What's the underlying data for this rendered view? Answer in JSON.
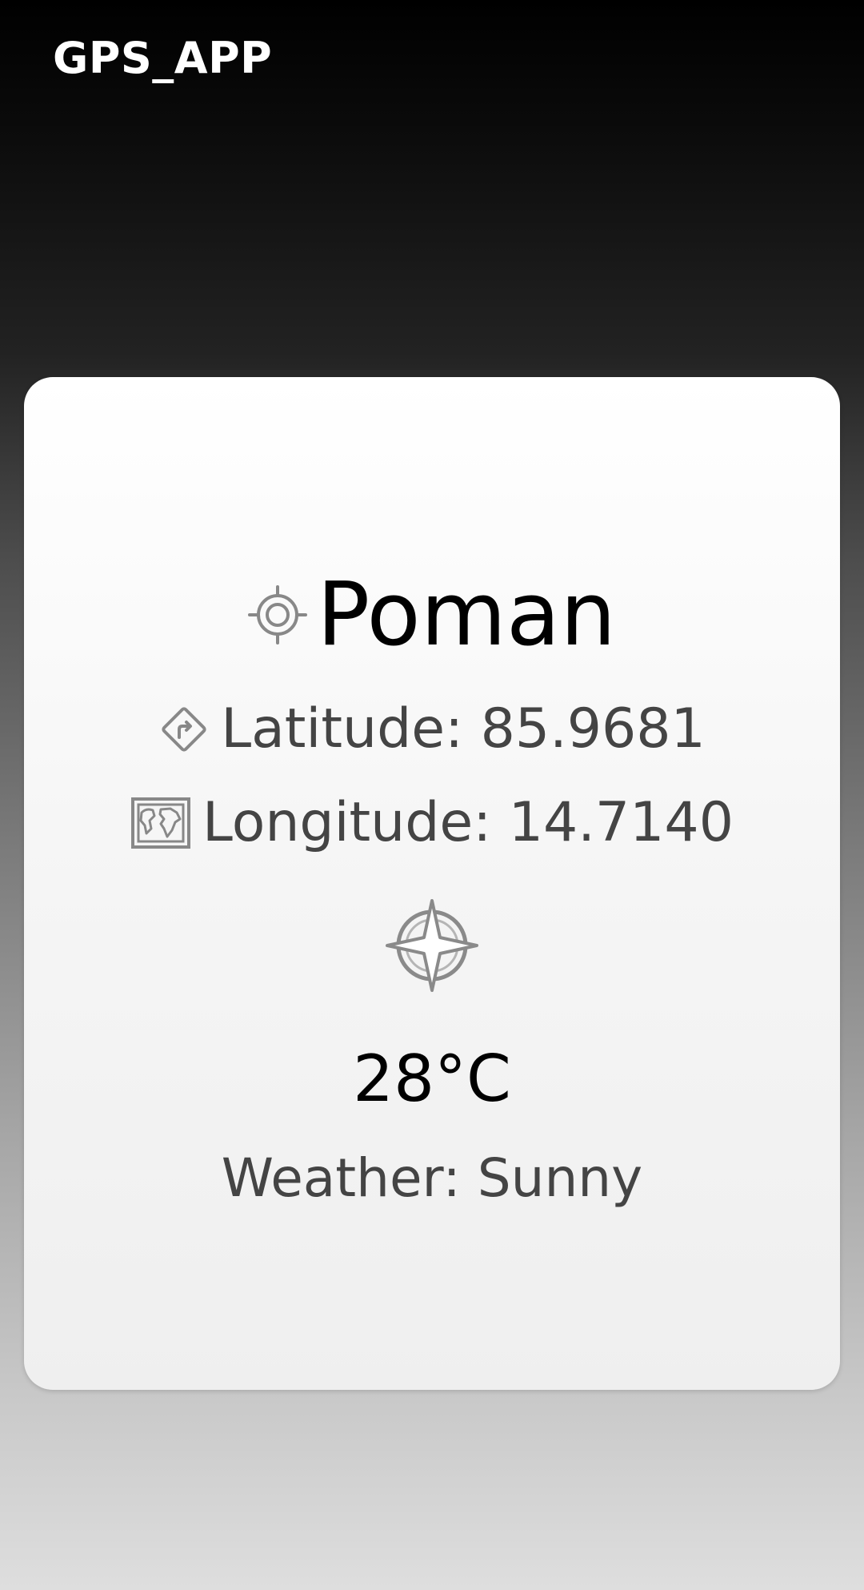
{
  "app": {
    "title": "GPS_APP"
  },
  "location": {
    "city": "Poman",
    "latitude": "Latitude: 85.9681",
    "longitude": "Longitude: 14.7140"
  },
  "weather": {
    "temperature": "28°C",
    "condition": "Weather: Sunny"
  },
  "icons": {
    "city": "crosshair-icon",
    "latitude": "directions-sign-icon",
    "longitude": "world-map-icon",
    "compass": "compass-icon"
  }
}
